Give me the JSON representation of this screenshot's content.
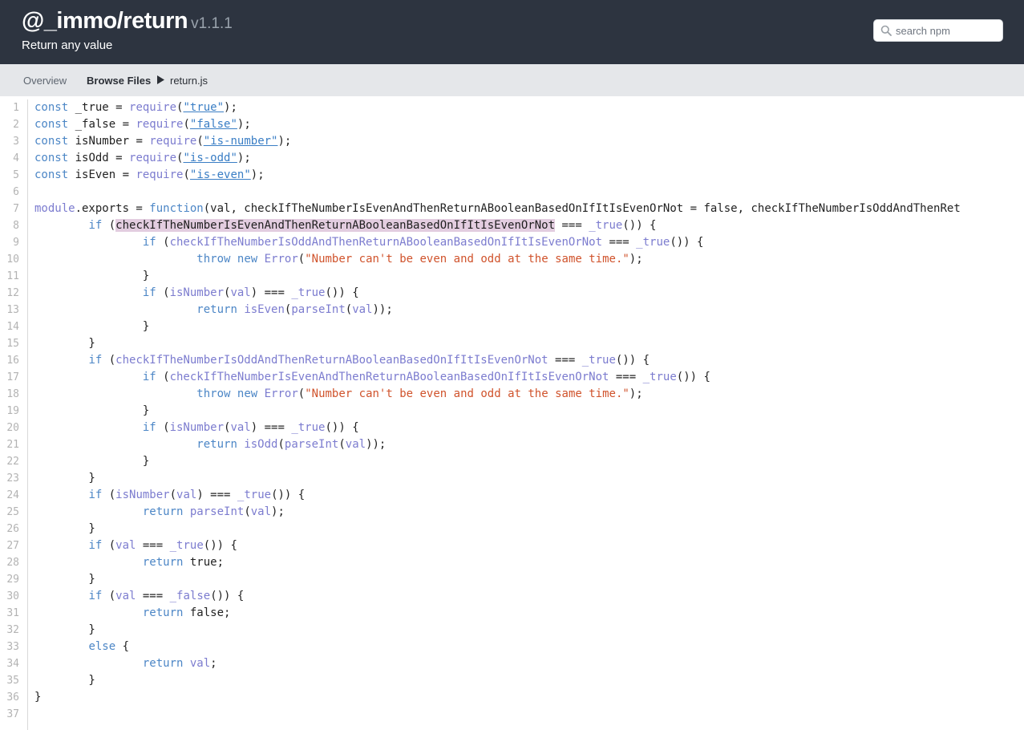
{
  "header": {
    "package_name": "@_immo/return",
    "version": "v1.1.1",
    "description": "Return any value",
    "search_placeholder": "search npm"
  },
  "subnav": {
    "overview": "Overview",
    "browse_files": "Browse Files",
    "filename": "return.js"
  },
  "icons": {
    "search": "search-icon",
    "breadcrumb": "caret-right-icon"
  },
  "colors": {
    "header_bg": "#2d3440",
    "subnav_bg": "#e5e7ea",
    "keyword": "#4c86c6",
    "identifier": "#7c7ccf",
    "string": "#d0532c",
    "highlight": "#e3cde0"
  },
  "code_lines": [
    [
      {
        "t": "const",
        "c": "kw"
      },
      {
        "t": " _true = "
      },
      {
        "t": "require",
        "c": "fn"
      },
      {
        "t": "("
      },
      {
        "t": "\"true\"",
        "c": "lnk"
      },
      {
        "t": ");"
      }
    ],
    [
      {
        "t": "const",
        "c": "kw"
      },
      {
        "t": " _false = "
      },
      {
        "t": "require",
        "c": "fn"
      },
      {
        "t": "("
      },
      {
        "t": "\"false\"",
        "c": "lnk"
      },
      {
        "t": ");"
      }
    ],
    [
      {
        "t": "const",
        "c": "kw"
      },
      {
        "t": " isNumber = "
      },
      {
        "t": "require",
        "c": "fn"
      },
      {
        "t": "("
      },
      {
        "t": "\"is-number\"",
        "c": "lnk"
      },
      {
        "t": ");"
      }
    ],
    [
      {
        "t": "const",
        "c": "kw"
      },
      {
        "t": " isOdd = "
      },
      {
        "t": "require",
        "c": "fn"
      },
      {
        "t": "("
      },
      {
        "t": "\"is-odd\"",
        "c": "lnk"
      },
      {
        "t": ");"
      }
    ],
    [
      {
        "t": "const",
        "c": "kw"
      },
      {
        "t": " isEven = "
      },
      {
        "t": "require",
        "c": "fn"
      },
      {
        "t": "("
      },
      {
        "t": "\"is-even\"",
        "c": "lnk"
      },
      {
        "t": ");"
      }
    ],
    [],
    [
      {
        "t": "module",
        "c": "vr"
      },
      {
        "t": ".exports = "
      },
      {
        "t": "function",
        "c": "kw"
      },
      {
        "t": "(val, checkIfTheNumberIsEvenAndThenReturnABooleanBasedOnIfItIsEvenOrNot = false, checkIfTheNumberIsOddAndThenRet"
      }
    ],
    [
      {
        "t": "        "
      },
      {
        "t": "if",
        "c": "kw"
      },
      {
        "t": " ("
      },
      {
        "t": "checkIfTheNumberIsEvenAndThenReturnABooleanBasedOnIfItIsEvenOrNot",
        "c": "hl"
      },
      {
        "t": " === "
      },
      {
        "t": "_true",
        "c": "fn"
      },
      {
        "t": "()) {"
      }
    ],
    [
      {
        "t": "                "
      },
      {
        "t": "if",
        "c": "kw"
      },
      {
        "t": " ("
      },
      {
        "t": "checkIfTheNumberIsOddAndThenReturnABooleanBasedOnIfItIsEvenOrNot",
        "c": "vr"
      },
      {
        "t": " === "
      },
      {
        "t": "_true",
        "c": "fn"
      },
      {
        "t": "()) {"
      }
    ],
    [
      {
        "t": "                        "
      },
      {
        "t": "throw",
        "c": "kw"
      },
      {
        "t": " "
      },
      {
        "t": "new",
        "c": "kw"
      },
      {
        "t": " "
      },
      {
        "t": "Error",
        "c": "fn"
      },
      {
        "t": "("
      },
      {
        "t": "\"Number can't be even and odd at the same time.\"",
        "c": "str"
      },
      {
        "t": ");"
      }
    ],
    [
      {
        "t": "                }"
      }
    ],
    [
      {
        "t": "                "
      },
      {
        "t": "if",
        "c": "kw"
      },
      {
        "t": " ("
      },
      {
        "t": "isNumber",
        "c": "fn"
      },
      {
        "t": "("
      },
      {
        "t": "val",
        "c": "vr"
      },
      {
        "t": ") === "
      },
      {
        "t": "_true",
        "c": "fn"
      },
      {
        "t": "()) {"
      }
    ],
    [
      {
        "t": "                        "
      },
      {
        "t": "return",
        "c": "kw"
      },
      {
        "t": " "
      },
      {
        "t": "isEven",
        "c": "fn"
      },
      {
        "t": "("
      },
      {
        "t": "parseInt",
        "c": "fn"
      },
      {
        "t": "("
      },
      {
        "t": "val",
        "c": "vr"
      },
      {
        "t": "));"
      }
    ],
    [
      {
        "t": "                }"
      }
    ],
    [
      {
        "t": "        }"
      }
    ],
    [
      {
        "t": "        "
      },
      {
        "t": "if",
        "c": "kw"
      },
      {
        "t": " ("
      },
      {
        "t": "checkIfTheNumberIsOddAndThenReturnABooleanBasedOnIfItIsEvenOrNot",
        "c": "vr"
      },
      {
        "t": " === "
      },
      {
        "t": "_true",
        "c": "fn"
      },
      {
        "t": "()) {"
      }
    ],
    [
      {
        "t": "                "
      },
      {
        "t": "if",
        "c": "kw"
      },
      {
        "t": " ("
      },
      {
        "t": "checkIfTheNumberIsEvenAndThenReturnABooleanBasedOnIfItIsEvenOrNot",
        "c": "vr"
      },
      {
        "t": " === "
      },
      {
        "t": "_true",
        "c": "fn"
      },
      {
        "t": "()) {"
      }
    ],
    [
      {
        "t": "                        "
      },
      {
        "t": "throw",
        "c": "kw"
      },
      {
        "t": " "
      },
      {
        "t": "new",
        "c": "kw"
      },
      {
        "t": " "
      },
      {
        "t": "Error",
        "c": "fn"
      },
      {
        "t": "("
      },
      {
        "t": "\"Number can't be even and odd at the same time.\"",
        "c": "str"
      },
      {
        "t": ");"
      }
    ],
    [
      {
        "t": "                }"
      }
    ],
    [
      {
        "t": "                "
      },
      {
        "t": "if",
        "c": "kw"
      },
      {
        "t": " ("
      },
      {
        "t": "isNumber",
        "c": "fn"
      },
      {
        "t": "("
      },
      {
        "t": "val",
        "c": "vr"
      },
      {
        "t": ") === "
      },
      {
        "t": "_true",
        "c": "fn"
      },
      {
        "t": "()) {"
      }
    ],
    [
      {
        "t": "                        "
      },
      {
        "t": "return",
        "c": "kw"
      },
      {
        "t": " "
      },
      {
        "t": "isOdd",
        "c": "fn"
      },
      {
        "t": "("
      },
      {
        "t": "parseInt",
        "c": "fn"
      },
      {
        "t": "("
      },
      {
        "t": "val",
        "c": "vr"
      },
      {
        "t": "));"
      }
    ],
    [
      {
        "t": "                }"
      }
    ],
    [
      {
        "t": "        }"
      }
    ],
    [
      {
        "t": "        "
      },
      {
        "t": "if",
        "c": "kw"
      },
      {
        "t": " ("
      },
      {
        "t": "isNumber",
        "c": "fn"
      },
      {
        "t": "("
      },
      {
        "t": "val",
        "c": "vr"
      },
      {
        "t": ") === "
      },
      {
        "t": "_true",
        "c": "fn"
      },
      {
        "t": "()) {"
      }
    ],
    [
      {
        "t": "                "
      },
      {
        "t": "return",
        "c": "kw"
      },
      {
        "t": " "
      },
      {
        "t": "parseInt",
        "c": "fn"
      },
      {
        "t": "("
      },
      {
        "t": "val",
        "c": "vr"
      },
      {
        "t": ");"
      }
    ],
    [
      {
        "t": "        }"
      }
    ],
    [
      {
        "t": "        "
      },
      {
        "t": "if",
        "c": "kw"
      },
      {
        "t": " ("
      },
      {
        "t": "val",
        "c": "vr"
      },
      {
        "t": " === "
      },
      {
        "t": "_true",
        "c": "fn"
      },
      {
        "t": "()) {"
      }
    ],
    [
      {
        "t": "                "
      },
      {
        "t": "return",
        "c": "kw"
      },
      {
        "t": " true;"
      }
    ],
    [
      {
        "t": "        }"
      }
    ],
    [
      {
        "t": "        "
      },
      {
        "t": "if",
        "c": "kw"
      },
      {
        "t": " ("
      },
      {
        "t": "val",
        "c": "vr"
      },
      {
        "t": " === "
      },
      {
        "t": "_false",
        "c": "fn"
      },
      {
        "t": "()) {"
      }
    ],
    [
      {
        "t": "                "
      },
      {
        "t": "return",
        "c": "kw"
      },
      {
        "t": " false;"
      }
    ],
    [
      {
        "t": "        }"
      }
    ],
    [
      {
        "t": "        "
      },
      {
        "t": "else",
        "c": "kw"
      },
      {
        "t": " {"
      }
    ],
    [
      {
        "t": "                "
      },
      {
        "t": "return",
        "c": "kw"
      },
      {
        "t": " "
      },
      {
        "t": "val",
        "c": "vr"
      },
      {
        "t": ";"
      }
    ],
    [
      {
        "t": "        }"
      }
    ],
    [
      {
        "t": "}"
      }
    ],
    []
  ]
}
